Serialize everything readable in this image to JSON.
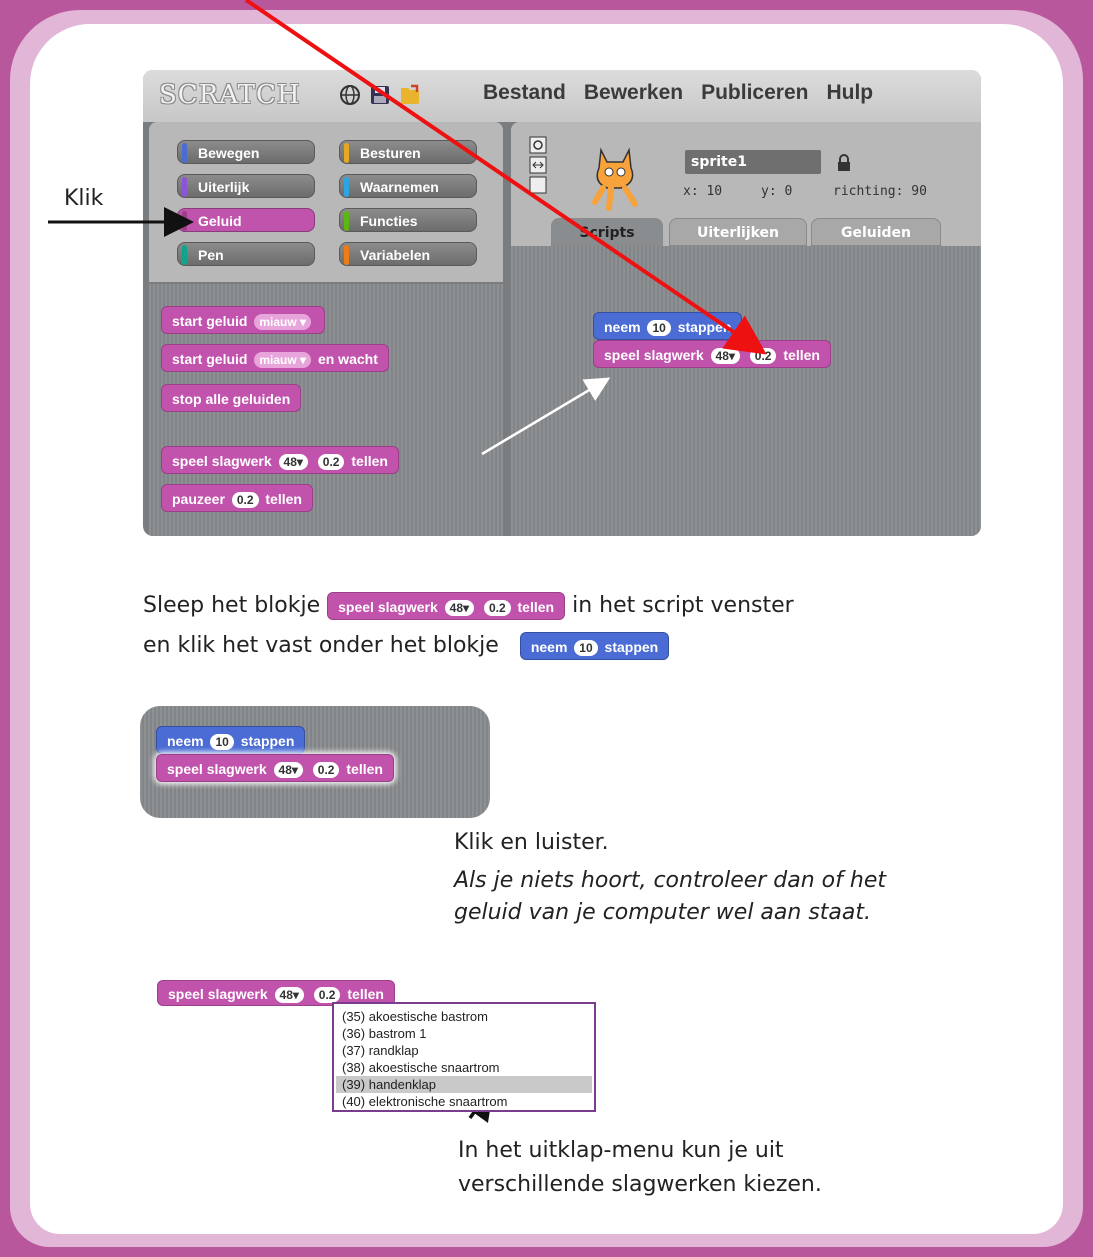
{
  "scratch": {
    "logo": "SCRATCH",
    "menu": [
      "Bestand",
      "Bewerken",
      "Publiceren",
      "Hulp"
    ],
    "categories": [
      {
        "label": "Bewegen",
        "color": "#4a6cd4"
      },
      {
        "label": "Besturen",
        "color": "#e6a822"
      },
      {
        "label": "Uiterlijk",
        "color": "#8a55d7"
      },
      {
        "label": "Waarnemen",
        "color": "#2ca5e2"
      },
      {
        "label": "Geluid",
        "color": "#c054ad"
      },
      {
        "label": "Functies",
        "color": "#5cb712"
      },
      {
        "label": "Pen",
        "color": "#0fa58a"
      },
      {
        "label": "Variabelen",
        "color": "#ee7d16"
      }
    ],
    "palette_blocks": {
      "start_sound": "start geluid",
      "start_sound_value": "miauw",
      "start_sound_wait": "start geluid",
      "start_sound_wait_value": "miauw",
      "start_sound_wait_suffix": "en wacht",
      "stop_all": "stop alle geluiden",
      "drum_prefix": "speel slagwerk",
      "drum_value": "48",
      "drum_beats": "0.2",
      "drum_suffix": "tellen",
      "rest_prefix": "pauzeer",
      "rest_beats": "0.2",
      "rest_suffix": "tellen"
    },
    "sprite": {
      "name": "sprite1",
      "x_label": "x: 10",
      "y_label": "y: 0",
      "direction_label": "richting: 90"
    },
    "tabs": [
      "Scripts",
      "Uiterlijken",
      "Geluiden"
    ],
    "script_blocks": {
      "move_prefix": "neem",
      "move_value": "10",
      "move_suffix": "stappen",
      "drum_prefix": "speel slagwerk",
      "drum_value": "48",
      "drum_beats": "0.2",
      "drum_suffix": "tellen"
    }
  },
  "labels": {
    "klik": "Klik"
  },
  "instruction1": {
    "part1": "Sleep het blokje",
    "part2": "in het script venster",
    "line2": "en klik het vast onder het blokje"
  },
  "instruction2": {
    "line1": "Klik en luister.",
    "line2": "Als je niets hoort, controleer dan of het",
    "line3": "geluid van je computer wel aan staat."
  },
  "instruction3": {
    "line1": "In het uitklap-menu kun je uit",
    "line2": "verschillende slagwerken kiezen."
  },
  "block_text": {
    "neem": "neem",
    "ten": "10",
    "stappen": "stappen",
    "speel": "speel slagwerk",
    "v48": "48",
    "v02": "0.2",
    "tellen": "tellen"
  },
  "dropdown": {
    "items": [
      "(35) akoestische bastrom",
      "(36) bastrom 1",
      "(37) randklap",
      "(38) akoestische snaartrom",
      "(39) handenklap",
      "(40) elektronische snaartrom"
    ],
    "highlighted": "(39) handenklap"
  },
  "colors": {
    "sound_block": "#c153ad",
    "motion_block": "#4a6cd4",
    "border": "#b9579d",
    "annotation_arrow": "#ee1111"
  }
}
